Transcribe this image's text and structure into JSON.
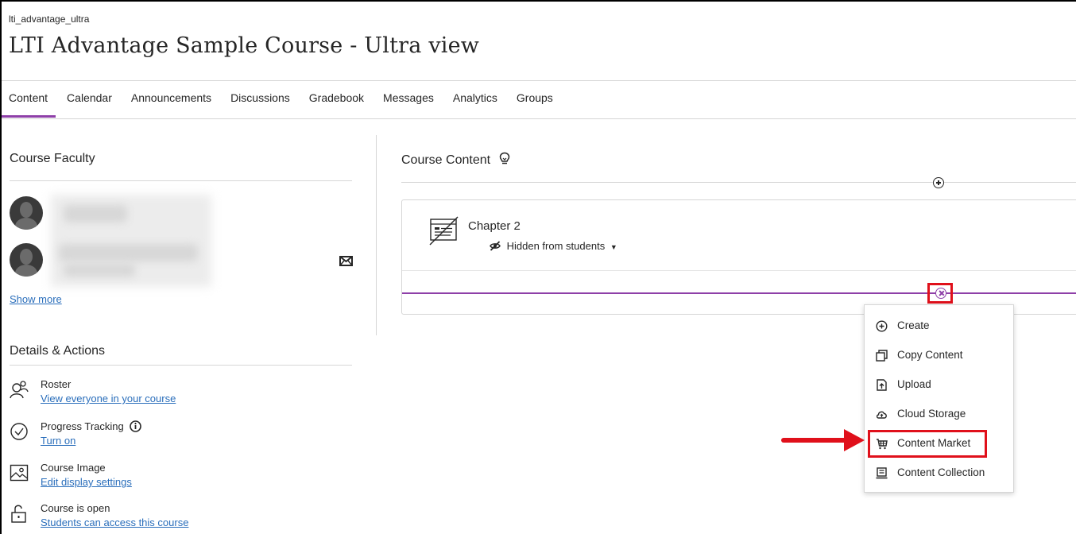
{
  "course": {
    "id": "lti_advantage_ultra",
    "title": "LTI Advantage Sample Course - Ultra view"
  },
  "nav": {
    "tabs": [
      {
        "label": "Content",
        "active": true
      },
      {
        "label": "Calendar"
      },
      {
        "label": "Announcements"
      },
      {
        "label": "Discussions"
      },
      {
        "label": "Gradebook"
      },
      {
        "label": "Messages"
      },
      {
        "label": "Analytics"
      },
      {
        "label": "Groups"
      }
    ]
  },
  "faculty": {
    "heading": "Course Faculty",
    "show_more": "Show more",
    "icons": [
      "avatar",
      "mail-icon"
    ]
  },
  "details": {
    "heading": "Details & Actions",
    "items": [
      {
        "title": "Roster",
        "link": "View everyone in your course",
        "icon": "roster-icon"
      },
      {
        "title": "Progress Tracking",
        "link": "Turn on",
        "icon": "checkmark-circle-icon"
      },
      {
        "title": "Course Image",
        "link": "Edit display settings",
        "icon": "image-icon"
      },
      {
        "title": "Course is open",
        "link": "Students can access this course",
        "icon": "unlock-icon"
      }
    ]
  },
  "content": {
    "heading": "Course Content",
    "chapter": {
      "title": "Chapter 2",
      "visibility": "Hidden from students"
    }
  },
  "menu": {
    "items": [
      {
        "label": "Create",
        "icon": "plus-circle-icon"
      },
      {
        "label": "Copy Content",
        "icon": "copy-icon"
      },
      {
        "label": "Upload",
        "icon": "upload-icon"
      },
      {
        "label": "Cloud Storage",
        "icon": "cloud-icon"
      },
      {
        "label": "Content Market",
        "icon": "market-icon",
        "highlighted": true
      },
      {
        "label": "Content Collection",
        "icon": "collection-icon"
      }
    ]
  },
  "colors": {
    "accent": "#8e3fa8",
    "link": "#2a6ebb",
    "annotation": "#e0101b"
  }
}
